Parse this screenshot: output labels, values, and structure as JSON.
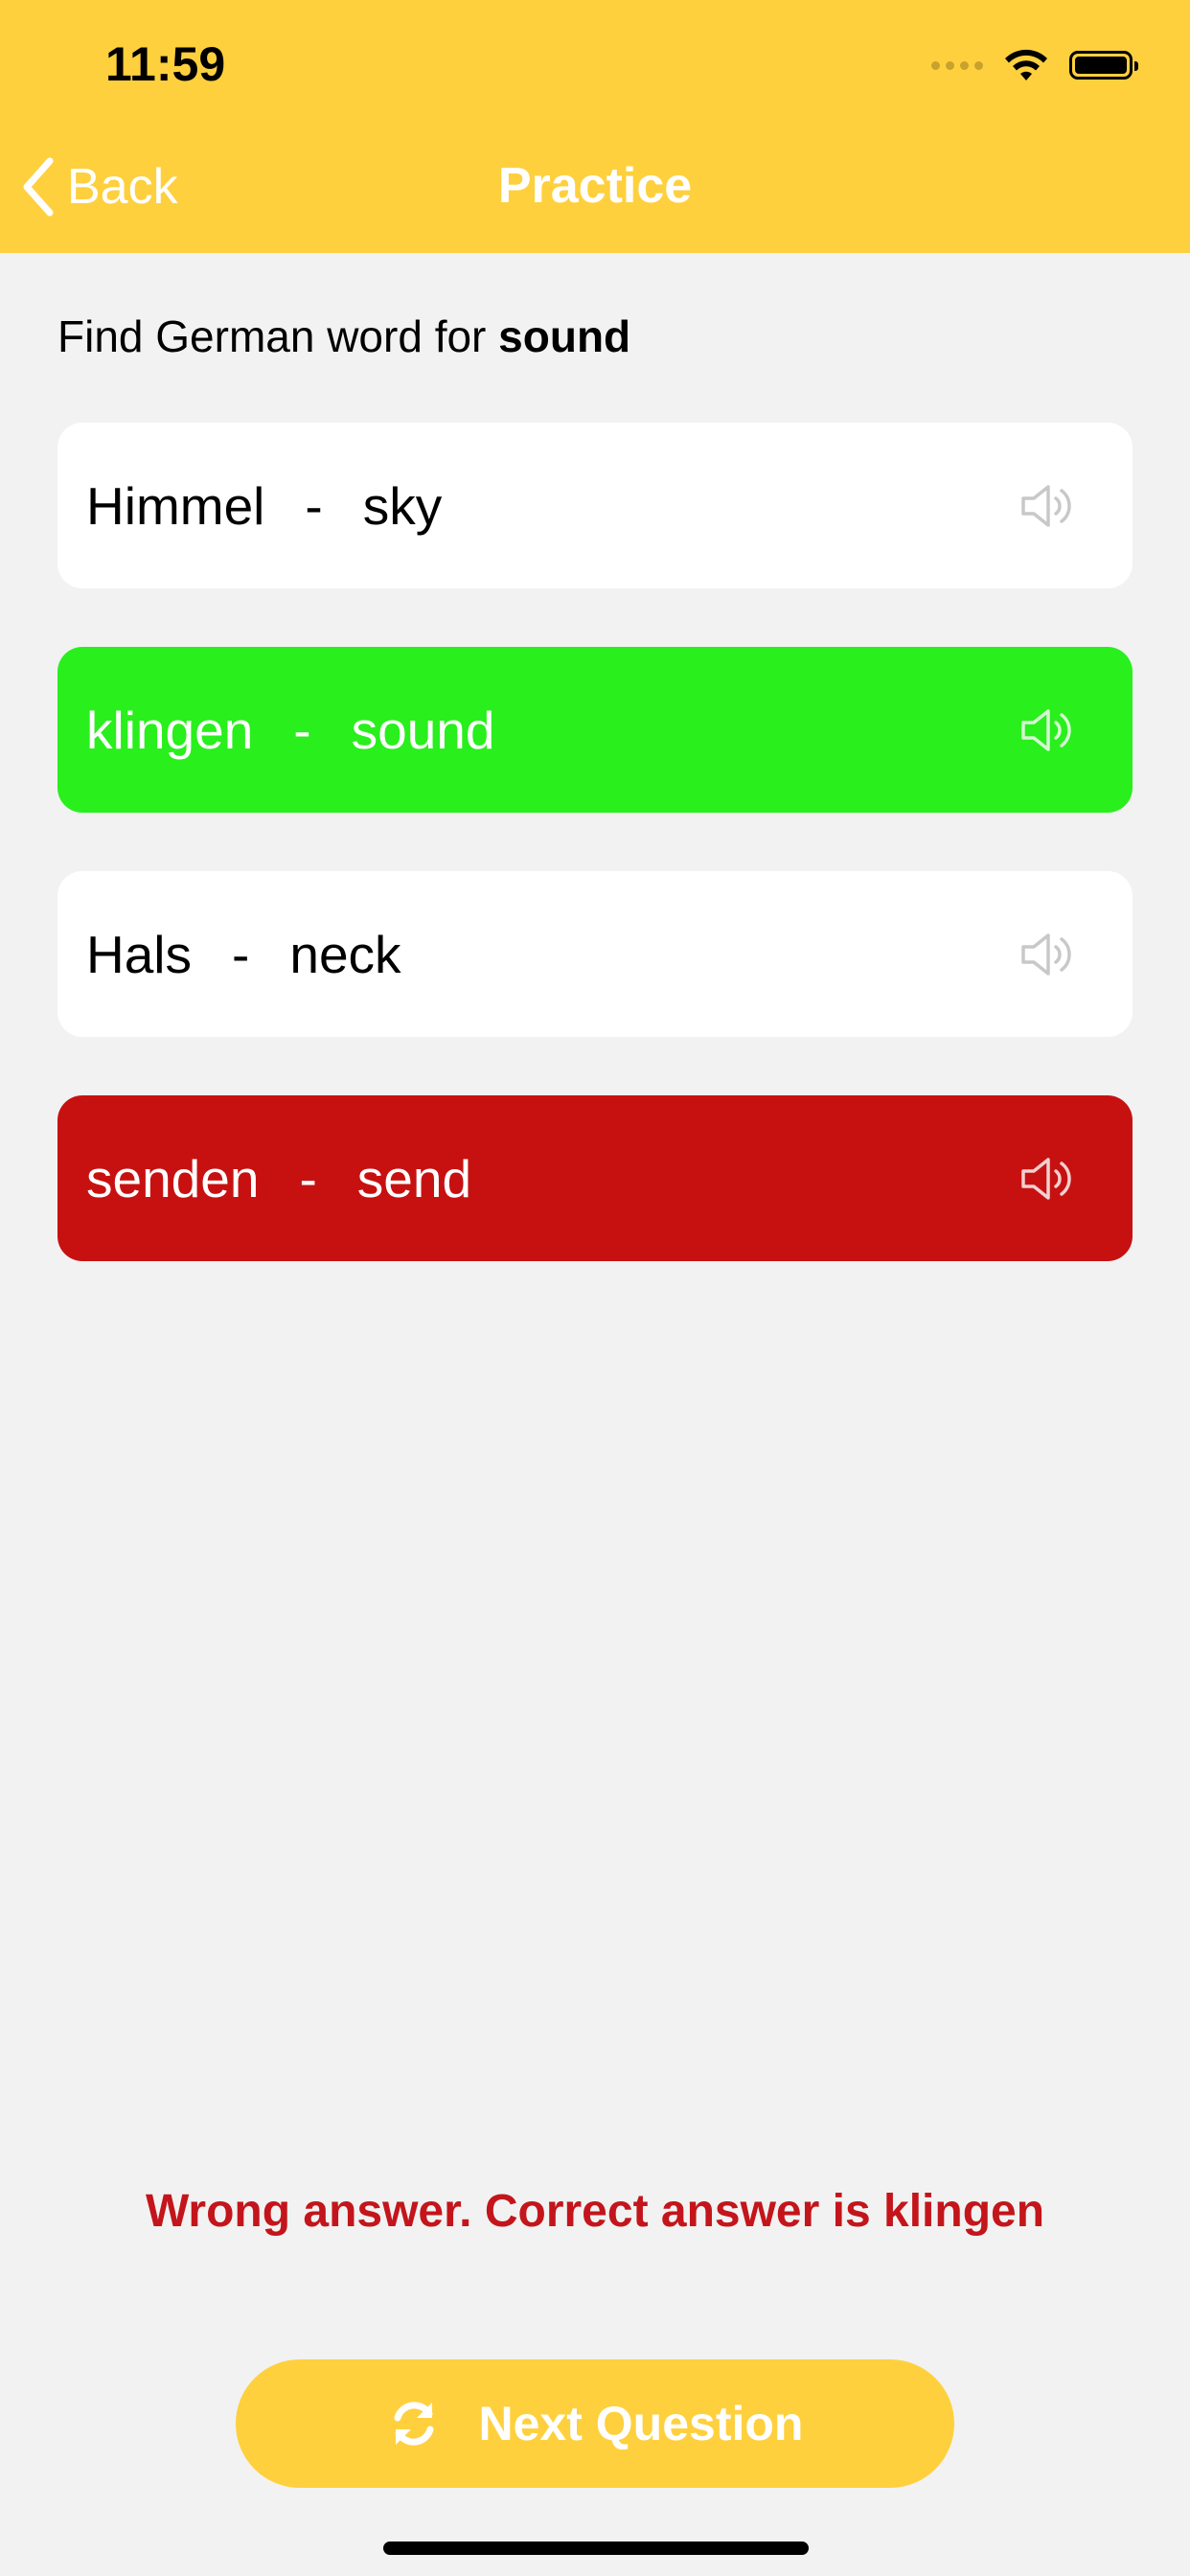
{
  "status_bar": {
    "time": "11:59"
  },
  "nav": {
    "back_label": "Back",
    "title": "Practice"
  },
  "question": {
    "prefix": "Find German word for ",
    "target": "sound"
  },
  "options": [
    {
      "german": "Himmel",
      "separator": "-",
      "english": "sky",
      "state": "neutral"
    },
    {
      "german": "klingen",
      "separator": "-",
      "english": "sound",
      "state": "correct"
    },
    {
      "german": "Hals",
      "separator": "-",
      "english": "neck",
      "state": "neutral"
    },
    {
      "german": "senden",
      "separator": "-",
      "english": "send",
      "state": "wrong"
    }
  ],
  "feedback": {
    "message": "Wrong answer. Correct answer is klingen"
  },
  "next_button": {
    "label": "Next Question"
  },
  "colors": {
    "accent": "#ffd03d",
    "correct": "#29ef1c",
    "wrong": "#c71111",
    "feedback_text": "#c3151b",
    "background": "#f2f2f2"
  },
  "icons": {
    "back": "chevron-left-icon",
    "speaker": "speaker-icon",
    "refresh": "refresh-icon",
    "wifi": "wifi-icon",
    "battery": "battery-icon",
    "signal": "signal-icon"
  }
}
